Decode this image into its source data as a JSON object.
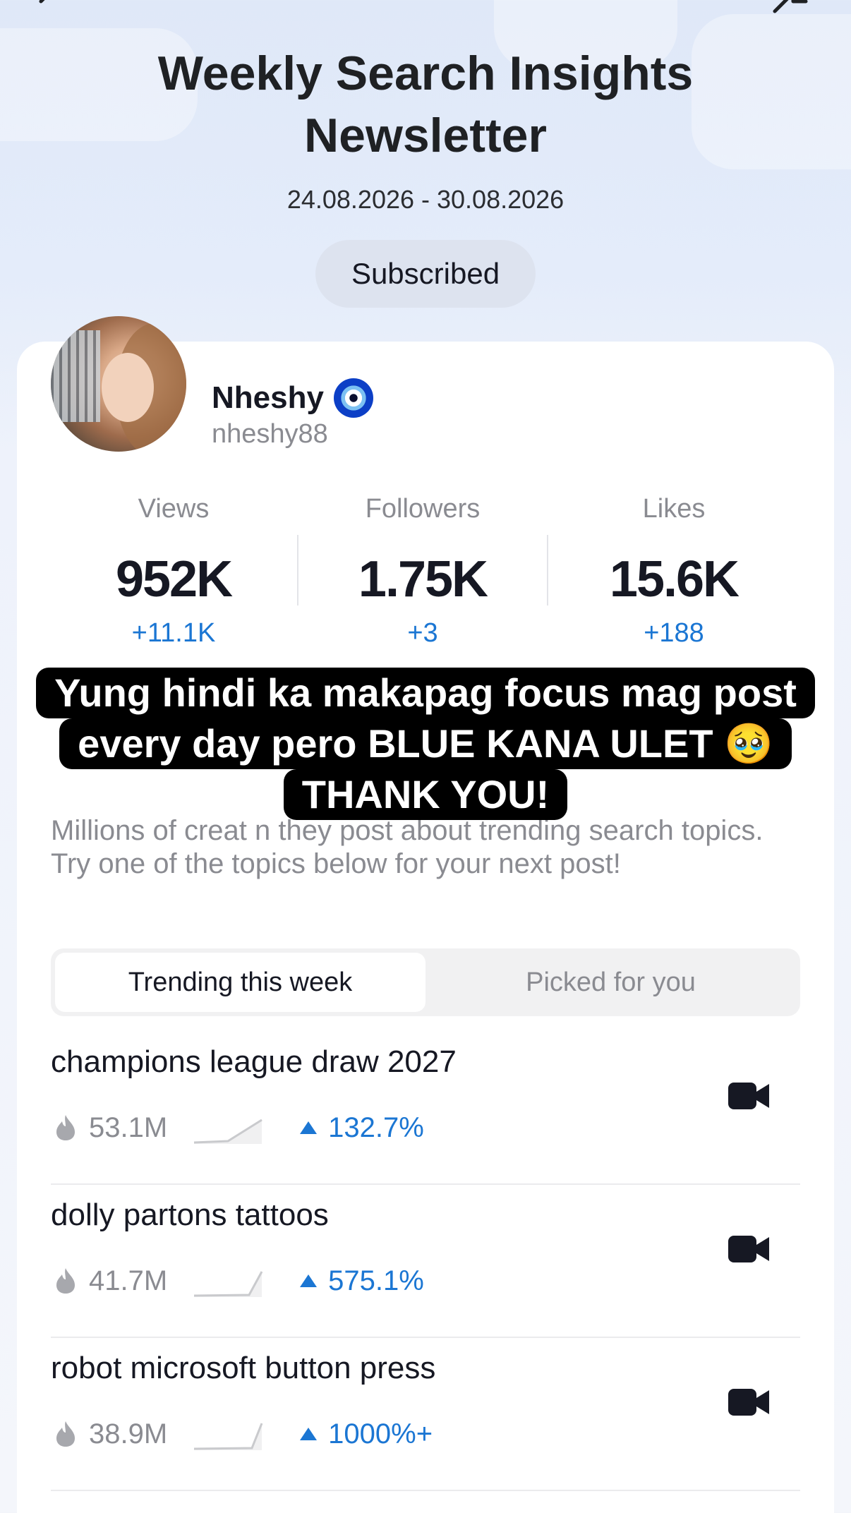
{
  "header": {
    "title": "Weekly Search Insights Newsletter",
    "date_range": "24.08.2026 - 30.08.2026",
    "subscribe_label": "Subscribed"
  },
  "profile": {
    "name": "Nheshy",
    "handle": "nheshy88",
    "badge_icon": "nazar-amulet-emoji"
  },
  "stats": [
    {
      "label": "Views",
      "value": "952K",
      "delta": "+11.1K"
    },
    {
      "label": "Followers",
      "value": "1.75K",
      "delta": "+3"
    },
    {
      "label": "Likes",
      "value": "15.6K",
      "delta": "+188"
    }
  ],
  "caption": {
    "lines": [
      "Yung hindi ka makapag focus mag post",
      "every day pero BLUE KANA ULET 🥹",
      "THANK YOU!"
    ]
  },
  "description": {
    "text": "Millions of creat                                           n they post about trending search topics. Try one of the topics below for your next post!"
  },
  "tabs": [
    {
      "label": "Trending this week",
      "active": true
    },
    {
      "label": "Picked for you",
      "active": false
    }
  ],
  "topics": [
    {
      "title": "champions league draw 2027",
      "volume": "53.1M",
      "growth": "132.7%"
    },
    {
      "title": "dolly partons tattoos",
      "volume": "41.7M",
      "growth": "575.1%"
    },
    {
      "title": "robot microsoft button press",
      "volume": "38.9M",
      "growth": "1000%+"
    }
  ],
  "colors": {
    "accent_blue": "#1b76d3",
    "muted_gray": "#8a8b91",
    "text_dark": "#161823"
  }
}
